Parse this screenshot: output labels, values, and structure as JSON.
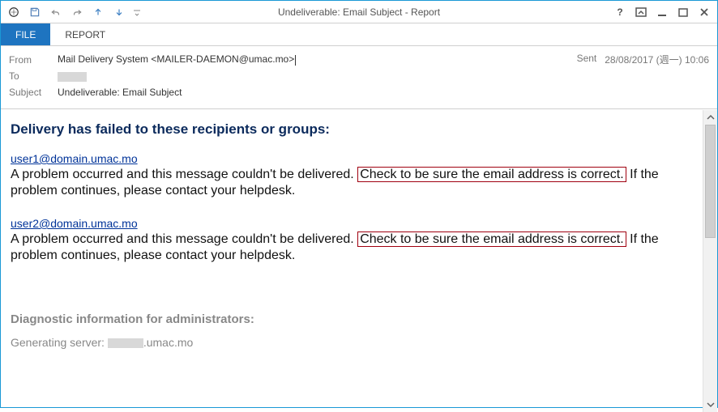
{
  "window": {
    "title": "Undeliverable: Email Subject - Report"
  },
  "tabs": {
    "file": "FILE",
    "report": "REPORT"
  },
  "header": {
    "from_label": "From",
    "from_value": "Mail Delivery System <MAILER-DAEMON@umac.mo>",
    "to_label": "To",
    "subject_label": "Subject",
    "subject_value": "Undeliverable: Email Subject",
    "sent_label": "Sent",
    "sent_value": "28/08/2017 (週一) 10:06"
  },
  "body": {
    "heading": "Delivery has failed to these recipients or groups:",
    "recipients": [
      {
        "email": "user1@domain.umac.mo",
        "msg_pre": "A problem occurred and this message couldn't be delivered. ",
        "msg_hl": "Check to be sure the email address is correct.",
        "msg_post": " If the problem continues, please contact your helpdesk."
      },
      {
        "email": "user2@domain.umac.mo",
        "msg_pre": "A problem occurred and this message couldn't be delivered. ",
        "msg_hl": "Check to be sure the email address is correct.",
        "msg_post": " If the problem continues, please contact your helpdesk."
      }
    ],
    "diag_heading": "Diagnostic information for administrators:",
    "gen_server_label": "Generating server: ",
    "gen_server_suffix": ".umac.mo"
  }
}
